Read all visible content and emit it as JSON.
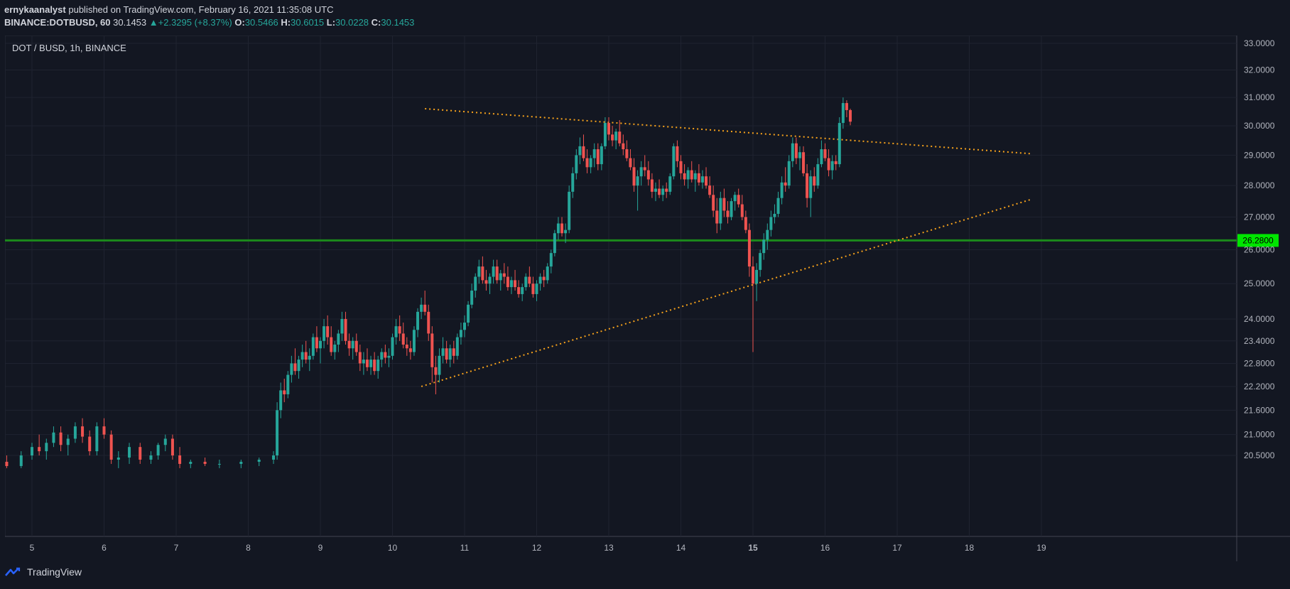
{
  "header": {
    "author": "ernykaanalyst",
    "published_text": "published on TradingView.com, February 16, 2021 11:35:08 UTC"
  },
  "ohlc": {
    "symbol": "BINANCE:DOTBUSD, 60",
    "last": "30.1453",
    "change": "+2.3295 (+8.37%)",
    "o_label": "O:",
    "o": "30.5466",
    "h_label": "H:",
    "h": "30.6015",
    "l_label": "L:",
    "l": "30.0228",
    "c_label": "C:",
    "c": "30.1453"
  },
  "footer": {
    "brand": "TradingView"
  },
  "chart_data": {
    "type": "candlestick",
    "title": "DOT / BUSD, 1h, BINANCE",
    "x_ticks": [
      "5",
      "6",
      "7",
      "8",
      "9",
      "10",
      "11",
      "12",
      "13",
      "14",
      "15",
      "16",
      "17",
      "18",
      "19"
    ],
    "bold_x_ticks": [
      "15"
    ],
    "y_scale": "log",
    "y_ticks": [
      "33.0000",
      "32.0000",
      "31.0000",
      "30.0000",
      "29.0000",
      "28.0000",
      "27.0000",
      "26.0000",
      "25.0000",
      "24.0000",
      "23.4000",
      "22.8000",
      "22.2000",
      "21.6000",
      "21.0000",
      "20.5000"
    ],
    "horizontal_line": {
      "value": 26.28,
      "label": "26.2800",
      "color": "#1b8a1b"
    },
    "trendlines": [
      {
        "name": "upper",
        "from": [
          10.45,
          30.6
        ],
        "to": [
          18.85,
          29.05
        ],
        "color": "#f7a21b"
      },
      {
        "name": "lower",
        "from": [
          10.4,
          22.2
        ],
        "to": [
          18.85,
          27.55
        ],
        "color": "#f7a21b"
      }
    ],
    "colors": {
      "up": "#26a69a",
      "down": "#ef5350",
      "background": "#131722",
      "grid": "#1f2330"
    },
    "candles": [
      [
        4.25,
        20.35,
        20.5,
        20.3,
        20.45
      ],
      [
        4.45,
        20.45,
        20.6,
        20.3,
        20.35
      ],
      [
        4.65,
        20.35,
        20.5,
        20.2,
        20.25
      ],
      [
        4.85,
        20.25,
        20.6,
        20.2,
        20.5
      ],
      [
        5.0,
        20.5,
        20.8,
        20.4,
        20.7
      ],
      [
        5.1,
        20.7,
        21.0,
        20.5,
        20.6
      ],
      [
        5.2,
        20.6,
        20.9,
        20.4,
        20.8
      ],
      [
        5.3,
        20.8,
        21.2,
        20.7,
        21.05
      ],
      [
        5.4,
        21.05,
        21.2,
        20.6,
        20.75
      ],
      [
        5.5,
        20.75,
        21.0,
        20.5,
        20.9
      ],
      [
        5.6,
        20.9,
        21.3,
        20.8,
        21.2
      ],
      [
        5.7,
        21.2,
        21.4,
        20.8,
        20.95
      ],
      [
        5.8,
        20.95,
        21.1,
        20.5,
        20.6
      ],
      [
        5.9,
        20.6,
        21.3,
        20.5,
        21.2
      ],
      [
        6.0,
        21.2,
        21.4,
        20.9,
        21.0
      ],
      [
        6.1,
        21.0,
        21.1,
        20.3,
        20.4
      ],
      [
        6.2,
        20.4,
        20.6,
        20.2,
        20.45
      ],
      [
        6.35,
        20.45,
        20.8,
        20.3,
        20.7
      ],
      [
        6.5,
        20.7,
        20.8,
        20.3,
        20.4
      ],
      [
        6.65,
        20.4,
        20.6,
        20.3,
        20.5
      ],
      [
        6.75,
        20.5,
        20.8,
        20.4,
        20.75
      ],
      [
        6.85,
        20.75,
        21.0,
        20.6,
        20.9
      ],
      [
        6.95,
        20.9,
        21.0,
        20.4,
        20.5
      ],
      [
        7.05,
        20.5,
        20.7,
        20.2,
        20.3
      ],
      [
        7.2,
        20.3,
        20.4,
        20.2,
        20.35
      ],
      [
        7.4,
        20.35,
        20.45,
        20.25,
        20.3
      ],
      [
        7.6,
        20.3,
        20.4,
        20.2,
        20.3
      ],
      [
        7.9,
        20.3,
        20.4,
        20.2,
        20.35
      ],
      [
        8.15,
        20.35,
        20.45,
        20.25,
        20.4
      ],
      [
        8.35,
        20.4,
        20.6,
        20.3,
        20.5
      ],
      [
        8.4,
        20.5,
        21.8,
        20.4,
        21.6
      ],
      [
        8.45,
        21.6,
        22.3,
        21.4,
        22.1
      ],
      [
        8.5,
        22.1,
        22.4,
        21.8,
        22.0
      ],
      [
        8.55,
        22.0,
        22.6,
        21.9,
        22.5
      ],
      [
        8.6,
        22.5,
        23.0,
        22.3,
        22.8
      ],
      [
        8.65,
        22.8,
        23.2,
        22.5,
        22.6
      ],
      [
        8.7,
        22.6,
        23.0,
        22.4,
        22.9
      ],
      [
        8.75,
        22.9,
        23.3,
        22.7,
        23.1
      ],
      [
        8.8,
        23.1,
        23.4,
        22.8,
        22.9
      ],
      [
        8.85,
        22.9,
        23.2,
        22.6,
        23.0
      ],
      [
        8.9,
        23.0,
        23.6,
        22.9,
        23.5
      ],
      [
        8.95,
        23.5,
        23.8,
        23.1,
        23.2
      ],
      [
        9.0,
        23.2,
        23.5,
        22.8,
        23.4
      ],
      [
        9.05,
        23.4,
        24.0,
        23.2,
        23.8
      ],
      [
        9.1,
        23.8,
        24.1,
        23.3,
        23.5
      ],
      [
        9.15,
        23.5,
        23.8,
        23.0,
        23.1
      ],
      [
        9.2,
        23.1,
        23.4,
        22.9,
        23.3
      ],
      [
        9.25,
        23.3,
        23.7,
        23.1,
        23.6
      ],
      [
        9.3,
        23.6,
        24.2,
        23.4,
        24.0
      ],
      [
        9.35,
        24.0,
        24.2,
        23.3,
        23.4
      ],
      [
        9.4,
        23.4,
        23.6,
        23.0,
        23.2
      ],
      [
        9.45,
        23.2,
        23.5,
        22.9,
        23.4
      ],
      [
        9.5,
        23.4,
        23.6,
        23.0,
        23.1
      ],
      [
        9.55,
        23.1,
        23.3,
        22.6,
        22.8
      ],
      [
        9.6,
        22.8,
        23.1,
        22.5,
        22.9
      ],
      [
        9.65,
        22.9,
        23.2,
        22.6,
        22.7
      ],
      [
        9.7,
        22.7,
        23.0,
        22.5,
        22.9
      ],
      [
        9.75,
        22.9,
        23.1,
        22.5,
        22.6
      ],
      [
        9.8,
        22.6,
        23.0,
        22.4,
        22.9
      ],
      [
        9.85,
        22.9,
        23.2,
        22.7,
        23.1
      ],
      [
        9.9,
        23.1,
        23.3,
        22.8,
        22.95
      ],
      [
        9.95,
        22.95,
        23.2,
        22.7,
        23.0
      ],
      [
        10.0,
        23.0,
        23.6,
        22.9,
        23.5
      ],
      [
        10.05,
        23.5,
        24.0,
        23.3,
        23.8
      ],
      [
        10.1,
        23.8,
        24.1,
        23.4,
        23.6
      ],
      [
        10.15,
        23.6,
        23.9,
        23.2,
        23.3
      ],
      [
        10.2,
        23.3,
        23.5,
        23.0,
        23.2
      ],
      [
        10.25,
        23.2,
        23.4,
        22.9,
        23.1
      ],
      [
        10.3,
        23.1,
        23.8,
        23.0,
        23.7
      ],
      [
        10.35,
        23.7,
        24.3,
        23.5,
        24.2
      ],
      [
        10.4,
        24.2,
        24.6,
        24.0,
        24.4
      ],
      [
        10.45,
        24.4,
        24.8,
        24.1,
        24.2
      ],
      [
        10.5,
        24.2,
        24.4,
        23.4,
        23.6
      ],
      [
        10.55,
        23.6,
        23.8,
        22.3,
        22.7
      ],
      [
        10.6,
        22.7,
        23.0,
        22.0,
        22.5
      ],
      [
        10.65,
        22.5,
        23.2,
        22.3,
        23.0
      ],
      [
        10.7,
        23.0,
        23.5,
        22.8,
        23.2
      ],
      [
        10.75,
        23.2,
        23.4,
        22.8,
        22.9
      ],
      [
        10.8,
        22.9,
        23.3,
        22.7,
        23.2
      ],
      [
        10.85,
        23.2,
        23.4,
        22.8,
        23.0
      ],
      [
        10.9,
        23.0,
        23.6,
        22.9,
        23.5
      ],
      [
        10.95,
        23.5,
        23.9,
        23.3,
        23.7
      ],
      [
        11.0,
        23.7,
        24.1,
        23.5,
        23.9
      ],
      [
        11.05,
        23.9,
        24.5,
        23.8,
        24.4
      ],
      [
        11.1,
        24.4,
        25.0,
        24.3,
        24.8
      ],
      [
        11.15,
        24.8,
        25.3,
        24.6,
        25.2
      ],
      [
        11.2,
        25.2,
        25.7,
        25.0,
        25.5
      ],
      [
        11.25,
        25.5,
        25.8,
        25.0,
        25.1
      ],
      [
        11.3,
        25.1,
        25.4,
        24.8,
        25.0
      ],
      [
        11.35,
        25.0,
        25.3,
        24.7,
        25.2
      ],
      [
        11.4,
        25.2,
        25.7,
        25.0,
        25.5
      ],
      [
        11.45,
        25.5,
        25.7,
        25.0,
        25.1
      ],
      [
        11.5,
        25.1,
        25.4,
        24.8,
        25.3
      ],
      [
        11.55,
        25.3,
        25.6,
        25.0,
        25.2
      ],
      [
        11.6,
        25.2,
        25.5,
        24.8,
        24.9
      ],
      [
        11.65,
        24.9,
        25.2,
        24.7,
        25.1
      ],
      [
        11.7,
        25.1,
        25.4,
        24.8,
        24.9
      ],
      [
        11.75,
        24.9,
        25.1,
        24.6,
        24.7
      ],
      [
        11.8,
        24.7,
        25.0,
        24.5,
        24.9
      ],
      [
        11.85,
        24.9,
        25.3,
        24.8,
        25.2
      ],
      [
        11.9,
        25.2,
        25.5,
        24.9,
        25.0
      ],
      [
        11.95,
        25.0,
        25.2,
        24.6,
        24.7
      ],
      [
        12.0,
        24.7,
        25.1,
        24.5,
        25.0
      ],
      [
        12.05,
        25.0,
        25.3,
        24.8,
        25.2
      ],
      [
        12.1,
        25.2,
        25.4,
        24.9,
        25.1
      ],
      [
        12.15,
        25.1,
        25.6,
        25.0,
        25.5
      ],
      [
        12.2,
        25.5,
        26.0,
        25.3,
        25.9
      ],
      [
        12.25,
        25.9,
        26.6,
        25.8,
        26.5
      ],
      [
        12.3,
        26.5,
        27.0,
        26.3,
        26.8
      ],
      [
        12.35,
        26.8,
        27.0,
        26.4,
        26.5
      ],
      [
        12.4,
        26.5,
        26.8,
        26.2,
        26.6
      ],
      [
        12.45,
        26.6,
        28.0,
        26.5,
        27.8
      ],
      [
        12.5,
        27.8,
        28.6,
        27.6,
        28.4
      ],
      [
        12.55,
        28.4,
        29.2,
        28.2,
        29.0
      ],
      [
        12.6,
        29.0,
        29.6,
        28.7,
        29.3
      ],
      [
        12.65,
        29.3,
        29.7,
        28.8,
        28.9
      ],
      [
        12.7,
        28.9,
        29.2,
        28.4,
        28.6
      ],
      [
        12.75,
        28.6,
        29.0,
        28.4,
        28.9
      ],
      [
        12.8,
        28.9,
        29.4,
        28.6,
        29.2
      ],
      [
        12.85,
        29.2,
        29.4,
        28.5,
        28.7
      ],
      [
        12.9,
        28.7,
        29.4,
        28.5,
        29.3
      ],
      [
        12.95,
        29.3,
        30.3,
        29.2,
        30.1
      ],
      [
        13.0,
        30.1,
        30.3,
        29.5,
        29.7
      ],
      [
        13.05,
        29.7,
        30.0,
        29.3,
        29.5
      ],
      [
        13.1,
        29.5,
        29.9,
        29.2,
        29.8
      ],
      [
        13.15,
        29.8,
        30.2,
        29.3,
        29.4
      ],
      [
        13.2,
        29.4,
        29.7,
        29.0,
        29.2
      ],
      [
        13.25,
        29.2,
        29.5,
        28.8,
        28.9
      ],
      [
        13.3,
        28.9,
        29.2,
        28.5,
        28.6
      ],
      [
        13.35,
        28.6,
        28.9,
        27.8,
        28.0
      ],
      [
        13.4,
        28.0,
        28.5,
        27.2,
        28.3
      ],
      [
        13.45,
        28.3,
        28.8,
        28.0,
        28.6
      ],
      [
        13.5,
        28.6,
        29.0,
        28.3,
        28.5
      ],
      [
        13.55,
        28.5,
        28.8,
        28.0,
        28.2
      ],
      [
        13.6,
        28.2,
        28.4,
        27.6,
        27.8
      ],
      [
        13.65,
        27.8,
        28.1,
        27.5,
        27.9
      ],
      [
        13.7,
        27.9,
        28.2,
        27.6,
        27.7
      ],
      [
        13.75,
        27.7,
        28.0,
        27.5,
        27.9
      ],
      [
        13.8,
        27.9,
        28.1,
        27.6,
        27.8
      ],
      [
        13.85,
        27.8,
        28.4,
        27.7,
        28.3
      ],
      [
        13.9,
        28.3,
        29.4,
        28.2,
        29.3
      ],
      [
        13.95,
        29.3,
        29.5,
        28.6,
        28.8
      ],
      [
        14.0,
        28.8,
        29.0,
        28.2,
        28.4
      ],
      [
        14.05,
        28.4,
        28.7,
        28.0,
        28.2
      ],
      [
        14.1,
        28.2,
        28.6,
        27.9,
        28.5
      ],
      [
        14.15,
        28.5,
        28.8,
        28.1,
        28.2
      ],
      [
        14.2,
        28.2,
        28.5,
        27.8,
        28.4
      ],
      [
        14.25,
        28.4,
        28.7,
        28.0,
        28.1
      ],
      [
        14.3,
        28.1,
        28.5,
        27.9,
        28.3
      ],
      [
        14.35,
        28.3,
        28.6,
        27.9,
        28.0
      ],
      [
        14.4,
        28.0,
        28.3,
        27.6,
        27.7
      ],
      [
        14.45,
        27.7,
        28.0,
        27.0,
        27.2
      ],
      [
        14.5,
        27.2,
        27.6,
        26.5,
        26.8
      ],
      [
        14.55,
        26.8,
        27.8,
        26.6,
        27.6
      ],
      [
        14.6,
        27.6,
        27.9,
        27.0,
        27.2
      ],
      [
        14.65,
        27.2,
        27.5,
        26.8,
        27.0
      ],
      [
        14.7,
        27.0,
        27.6,
        26.9,
        27.5
      ],
      [
        14.75,
        27.5,
        27.8,
        27.2,
        27.7
      ],
      [
        14.8,
        27.7,
        27.9,
        27.3,
        27.4
      ],
      [
        14.85,
        27.4,
        27.7,
        26.9,
        27.0
      ],
      [
        14.9,
        27.0,
        27.2,
        26.5,
        26.6
      ],
      [
        14.95,
        26.6,
        26.8,
        25.2,
        25.5
      ],
      [
        15.0,
        25.5,
        25.8,
        23.1,
        25.0
      ],
      [
        15.05,
        25.0,
        25.6,
        24.5,
        25.4
      ],
      [
        15.1,
        25.4,
        26.0,
        25.2,
        25.9
      ],
      [
        15.15,
        25.9,
        26.5,
        25.7,
        26.3
      ],
      [
        15.2,
        26.3,
        26.8,
        26.0,
        26.6
      ],
      [
        15.25,
        26.6,
        27.2,
        26.4,
        27.0
      ],
      [
        15.3,
        27.0,
        27.4,
        26.8,
        27.1
      ],
      [
        15.35,
        27.1,
        27.8,
        27.0,
        27.6
      ],
      [
        15.4,
        27.6,
        28.3,
        27.4,
        28.1
      ],
      [
        15.45,
        28.1,
        28.6,
        27.8,
        28.0
      ],
      [
        15.5,
        28.0,
        29.0,
        27.9,
        28.8
      ],
      [
        15.55,
        28.8,
        29.6,
        28.6,
        29.4
      ],
      [
        15.6,
        29.4,
        29.6,
        28.7,
        28.9
      ],
      [
        15.65,
        28.9,
        29.3,
        28.5,
        29.1
      ],
      [
        15.7,
        29.1,
        29.3,
        28.3,
        28.4
      ],
      [
        15.75,
        28.4,
        28.7,
        27.3,
        27.6
      ],
      [
        15.8,
        27.6,
        28.5,
        27.0,
        28.3
      ],
      [
        15.85,
        28.3,
        28.6,
        27.8,
        28.0
      ],
      [
        15.9,
        28.0,
        28.9,
        27.9,
        28.7
      ],
      [
        15.95,
        28.7,
        29.5,
        28.6,
        29.2
      ],
      [
        16.0,
        29.2,
        29.4,
        28.8,
        28.9
      ],
      [
        16.05,
        28.9,
        29.2,
        28.3,
        28.5
      ],
      [
        16.1,
        28.5,
        29.0,
        28.2,
        28.8
      ],
      [
        16.15,
        28.8,
        29.0,
        28.5,
        28.7
      ],
      [
        16.2,
        28.7,
        30.3,
        28.6,
        30.1
      ],
      [
        16.25,
        30.1,
        31.0,
        29.9,
        30.8
      ],
      [
        16.3,
        30.8,
        30.9,
        30.3,
        30.55
      ],
      [
        16.35,
        30.55,
        30.6,
        30.02,
        30.1453
      ]
    ]
  }
}
